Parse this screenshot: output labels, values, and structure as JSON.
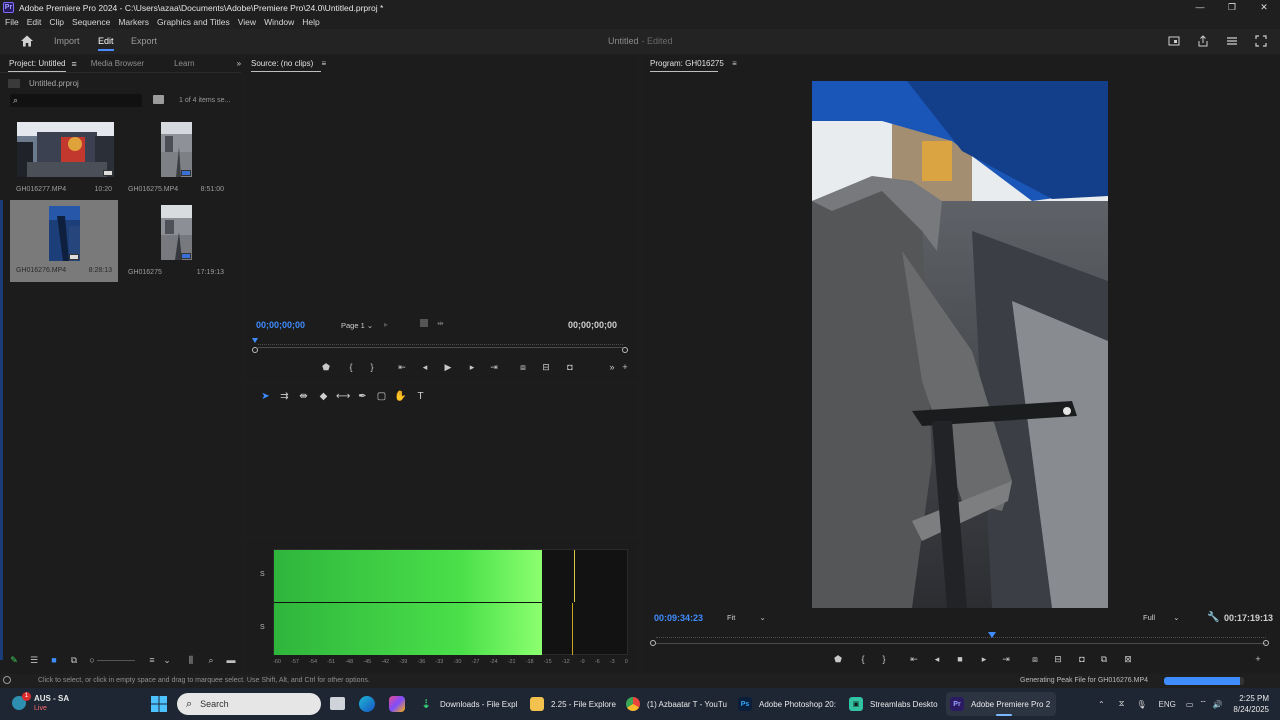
{
  "window": {
    "title": "Adobe Premiere Pro 2024 - C:\\Users\\azaa\\Documents\\Adobe\\Premiere Pro\\24.0\\Untitled.prproj *",
    "minimize": "—",
    "maximize": "❐",
    "close": "✕"
  },
  "menu": [
    "File",
    "Edit",
    "Clip",
    "Sequence",
    "Markers",
    "Graphics and Titles",
    "View",
    "Window",
    "Help"
  ],
  "header": {
    "tabs": [
      "Import",
      "Edit",
      "Export"
    ],
    "active_tab": "Edit",
    "doc_title": "Untitled",
    "doc_status": "- Edited"
  },
  "project": {
    "tabs": [
      "Project: Untitled",
      "Media Browser",
      "Learn"
    ],
    "file_name": "Untitled.prproj",
    "items_count": "1 of 4 items se...",
    "clips": [
      {
        "name": "GH016277.MP4",
        "duration": "10:20"
      },
      {
        "name": "GH016275.MP4",
        "duration": "8:51:00"
      },
      {
        "name": "GH016276.MP4",
        "duration": "8:28:13"
      },
      {
        "name": "GH016275",
        "duration": "17:19:13"
      }
    ]
  },
  "source": {
    "tab": "Source: (no clips)",
    "timecode_in": "00;00;00;00",
    "timecode_out": "00;00;00;00",
    "page": "Page 1"
  },
  "meters": {
    "labels": [
      "S",
      "S"
    ],
    "db_scale": [
      "-60",
      "-57",
      "-54",
      "-51",
      "-48",
      "-45",
      "-42",
      "-39",
      "-36",
      "-33",
      "-30",
      "-27",
      "-24",
      "-21",
      "-18",
      "-15",
      "-12",
      "-9",
      "-6",
      "-3",
      "0"
    ],
    "level_fraction": 0.755
  },
  "program": {
    "tab": "Program: GH016275",
    "timecode": "00:09:34:23",
    "duration": "00:17:19:13",
    "fit": "Fit",
    "quality": "Full",
    "playhead_fraction": 0.55
  },
  "status": {
    "hint": "Click to select, or click in empty space and drag to marquee select. Use Shift, Alt, and Ctrl for other options.",
    "task": "Generating Peak File for GH016276.MP4",
    "progress_fraction": 0.95
  },
  "taskbar": {
    "weather_location": "AUS - SA",
    "weather_status": "Live",
    "search_placeholder": "Search",
    "apps": [
      {
        "label": "Downloads - File Expl",
        "icon": "download-icon"
      },
      {
        "label": "2.25 - File Explore",
        "icon": "folder-icon"
      },
      {
        "label": "(1) Azbaatar T - YouTu",
        "icon": "chrome-icon"
      },
      {
        "label": "Adobe Photoshop 20:",
        "icon": "photoshop-icon"
      },
      {
        "label": "Streamlabs Deskto",
        "icon": "streamlabs-icon"
      },
      {
        "label": "Adobe Premiere Pro 2",
        "icon": "premiere-icon"
      }
    ],
    "language": "ENG",
    "time": "2:25 PM",
    "date": "8/24/2025"
  }
}
